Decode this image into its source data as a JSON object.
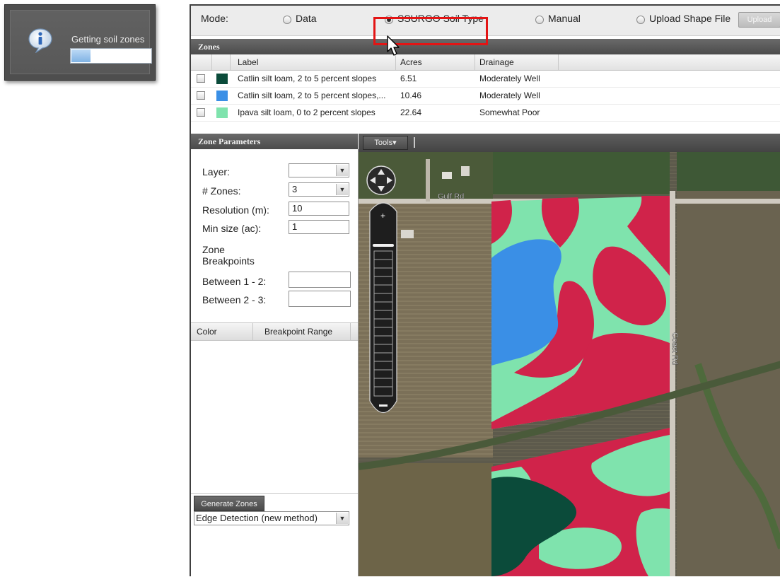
{
  "notification": {
    "message": "Getting soil zones",
    "icon": "info-icon",
    "progress": 0.24
  },
  "mode": {
    "label": "Mode:",
    "options": [
      {
        "label": "Data",
        "selected": false
      },
      {
        "label": "SSURGO Soil Type",
        "selected": true
      },
      {
        "label": "Manual",
        "selected": false
      },
      {
        "label": "Upload Shape File",
        "selected": false
      }
    ],
    "upload_button": "Upload"
  },
  "zones": {
    "title": "Zones",
    "columns": [
      "Label",
      "Acres",
      "Drainage"
    ],
    "rows": [
      {
        "label": "Catlin silt loam, 2 to 5 percent slopes",
        "acres": "6.51",
        "drainage": "Moderately Well",
        "color": "#0b4b3a"
      },
      {
        "label": "Catlin silt loam, 2 to 5 percent slopes,...",
        "acres": "10.46",
        "drainage": "Moderately Well",
        "color": "#3a8fe6"
      },
      {
        "label": "Ipava silt loam, 0 to 2 percent slopes",
        "acres": "22.64",
        "drainage": "Somewhat Poor",
        "color": "#7fe3ad"
      }
    ]
  },
  "zone_parameters": {
    "title": "Zone Parameters",
    "layer_label": "Layer:",
    "layer_value": "",
    "num_zones_label": "# Zones:",
    "num_zones_value": "3",
    "resolution_label": "Resolution (m):",
    "resolution_value": "10",
    "min_size_label": "Min size (ac):",
    "min_size_value": "1",
    "breakpoints_label_1": "Zone",
    "breakpoints_label_2": "Breakpoints",
    "between_12_label": "Between 1 - 2:",
    "between_12_value": "",
    "between_23_label": "Between 2 - 3:",
    "between_23_value": "",
    "table_columns": [
      "Color",
      "Breakpoint Range"
    ],
    "generate_button": "Generate Zones",
    "method_value": "Edge Detection (new method)"
  },
  "map": {
    "tools_label": "Tools",
    "road_labels": [
      "Gulf Rd",
      "Coast Rd"
    ],
    "zone_colors": {
      "dark_green": "#0b4b3a",
      "blue": "#3a8fe6",
      "light_green": "#7fe3ad",
      "red": "#d0234a"
    }
  }
}
